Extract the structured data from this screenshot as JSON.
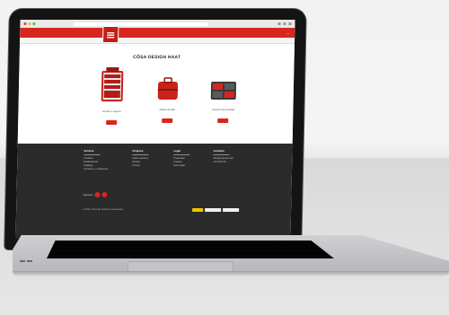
{
  "site": {
    "page_title": "CÔSA DESIGN HAAT",
    "header_link": "—",
    "products": [
      {
        "caption": "Armario 6 cajones",
        "icon": "tool-cabinet"
      },
      {
        "caption": "Maleta de taller",
        "icon": "tool-case"
      },
      {
        "caption": "Conjunto de bandejas",
        "icon": "tool-trays"
      }
    ],
    "footer": {
      "columns": [
        {
          "head": "Servicio",
          "items": [
            "Contacto",
            "Distribuidores",
            "Catálogo",
            "Términos y condiciones"
          ]
        },
        {
          "head": "Empresa",
          "items": [
            "Sobre nosotros",
            "Historia",
            "Prensa"
          ]
        },
        {
          "head": "Legal",
          "items": [
            "Privacidad",
            "Cookies",
            "Aviso legal"
          ]
        },
        {
          "head": "Contacto",
          "items": [
            "info@empresa.com",
            "+34 000 000"
          ]
        }
      ],
      "follow_label": "Síguenos",
      "copyright": "© 2021 Todos los derechos reservados"
    }
  },
  "colors": {
    "brand_red": "#d7261e",
    "footer_bg": "#2b2b2b"
  }
}
